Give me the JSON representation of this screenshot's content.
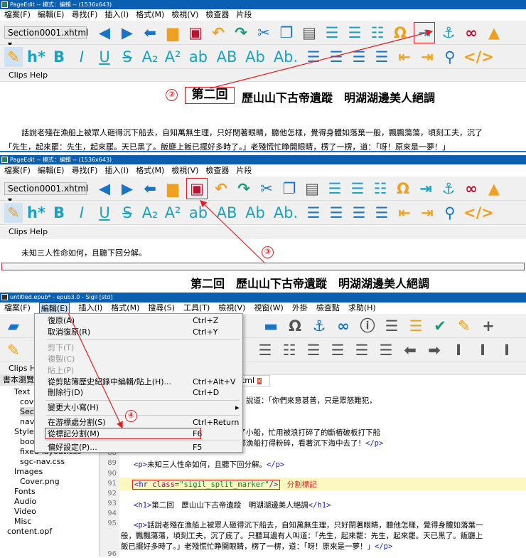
{
  "panel1": {
    "title": "PageEdit -- 模式：編輯 -- (1536x643)",
    "menu": [
      "檔案(F)",
      "編輯(E)",
      "尋找(F)",
      "插入(I)",
      "格式(M)",
      "檢視(V)",
      "檢查器",
      "片段"
    ],
    "file_select": "Section0001.xhtml",
    "text_toolbar": [
      "B",
      "I",
      "U",
      "S",
      "A₂",
      "A²",
      "ab",
      "AB",
      "Ab",
      "Ab."
    ],
    "clips": "Clips Help",
    "callout": "②",
    "heading_boxed": "第二回",
    "heading_rest": "歷山山下古帝遺蹤　明湖湖邊美人絕調",
    "para1": "話說老殘在漁船上被眾人砸得沉下船去，自知萬無生理，只好閉著眼睛，聽他怎樣，覺得身體如落葉一般，飄飄蕩蕩，頃刻工夫，沉了",
    "para2": "「先生，起來罷：先生，起來罷。天已黑了。飯廳上飯已擺好多時了。」老殘慌忙睁開眼睛，楞了一楞，道：「呀！原來是一夢！」"
  },
  "panel2": {
    "title": "PageEdit -- 模式：編輯 -- (1536x643)",
    "menu": [
      "檔案(F)",
      "編輯(E)",
      "尋找(F)",
      "插入(I)",
      "格式(M)",
      "檢視(V)",
      "檢查器",
      "片段"
    ],
    "file_select": "Section0001.xhtml",
    "text_toolbar": [
      "B",
      "I",
      "U",
      "S",
      "A₂",
      "A²",
      "ab",
      "AB",
      "Ab",
      "Ab."
    ],
    "clips": "Clips Help",
    "para": "未知三人性命如何，且聽下回分解。",
    "callout": "③",
    "heading": "第二回　歷山山下古帝遺蹤　明湖湖邊美人絕調"
  },
  "panel3": {
    "title": "untitled.epub* - epub3.0 - Sigil [std]",
    "menu": [
      "檔案(F)",
      "編輯(E)",
      "插入(I)",
      "格式(M)",
      "搜尋(S)",
      "工具(T)",
      "檢視(V)",
      "視窗(W)",
      "外掛",
      "檢查點",
      "求助(H)"
    ],
    "clips": "Clips H",
    "browser_title": "書本瀏覽",
    "tree": [
      "Text",
      "cove",
      "Sec",
      "nav",
      "Styles",
      "boo",
      "fixed-layout.css",
      "sgc-nav.css",
      "Images",
      "Cover.png",
      "Fonts",
      "Audio",
      "Video",
      "Misc",
      "content.opf"
    ],
    "tab": "html",
    "edit_menu": [
      {
        "label": "復原(A)",
        "key": "Ctrl+Z",
        "enabled": true
      },
      {
        "label": "取消復原(R)",
        "key": "Ctrl+Y",
        "enabled": true
      },
      {
        "label": "剪下(T)",
        "key": "",
        "enabled": false
      },
      {
        "label": "複製(C)",
        "key": "",
        "enabled": false
      },
      {
        "label": "貼上(P)",
        "key": "",
        "enabled": false
      },
      {
        "label": "從剪貼簿歷史紀錄中編輯/貼上(H)...",
        "key": "Ctrl+Alt+V",
        "enabled": true
      },
      {
        "label": "刪除行(D)",
        "key": "Ctrl+D",
        "enabled": true
      },
      {
        "label": "變更大小寫(H)",
        "key": "▸",
        "enabled": true
      },
      {
        "label": "在游標處分割(S)",
        "key": "Ctrl+Return",
        "enabled": true
      },
      {
        "label": "從標記分割(M)",
        "key": "F6",
        "enabled": true
      },
      {
        "label": "偏好設定(P)...",
        "key": "F5",
        "enabled": true
      }
    ],
    "callout": "④",
    "code_lines": {
      "l_a": "。內中有一個舵工，是船主的叔叔，說道：「你們來意甚善，只是眾怒難犯，",
      "l_b": "那知大船上人餘怒未息，看三人上了小船，忙用被浪打碎了的斷樁破板打下船",
      "l_c": "幾百個人用力亂砸？頃刻之間，將那漁船打得粉碎，看著沉下海中去了！",
      "l_c_tag": "</p>",
      "n88": "88",
      "n89": "89",
      "n90": "90",
      "n91": "91",
      "n92": "92",
      "n93": "93",
      "n94": "94",
      "n95": "95",
      "n96": "96",
      "p_open": "<p>",
      "l89": "未知三人性命如何，且聽下回分解。",
      "p_close": "</p>",
      "hr_open": "<hr ",
      "hr_attr": "class=",
      "hr_val": "\"sigil_split_marker\"",
      "hr_close": "/>",
      "split_label": "分割標記",
      "h1_open": "<h1>",
      "l93": "第二回　歷山山下古帝遺蹤　明湖湖邊美人絕調",
      "h1_close": "</h1>",
      "l95a": "話說老殘在漁船上被眾人砸得沉下船去，自知萬無生理，只好閉著眼睛，聽他怎樣，覺得身體如落葉一",
      "l95b": "般，飄飄蕩蕩，頃刻工夫，沉了底了。只聽耳邊有人叫道：「先生，起來罷：先生，起來罷。天已黑了。飯廳上",
      "l95c": "飯已擺好多時了。」老殘慌忙睁開眼睛，楞了一楞，道：「呀！原來是一夢！」"
    }
  },
  "colors": {
    "annotation": "#e02020",
    "titlebar": "#0b5fb0",
    "highlight_line": "#fdf8c0"
  }
}
